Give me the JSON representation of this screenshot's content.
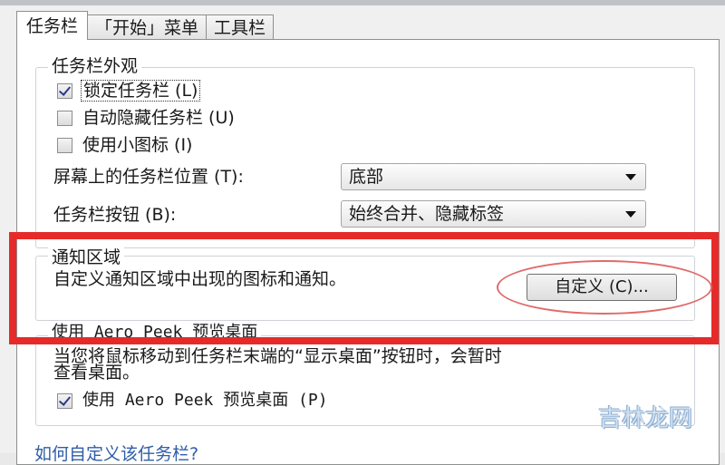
{
  "tabs": [
    {
      "label": "任务栏",
      "active": true
    },
    {
      "label": "「开始」菜单",
      "active": false
    },
    {
      "label": "工具栏",
      "active": false
    }
  ],
  "appearance": {
    "title": "任务栏外观",
    "lock_label": "锁定任务栏 (L)",
    "lock_checked": true,
    "autohide_label": "自动隐藏任务栏 (U)",
    "autohide_checked": false,
    "small_icons_label": "使用小图标 (I)",
    "small_icons_checked": false,
    "position_label": "屏幕上的任务栏位置 (T):",
    "position_value": "底部",
    "buttons_label": "任务栏按钮 (B):",
    "buttons_value": "始终合并、隐藏标签"
  },
  "notification": {
    "title": "通知区域",
    "description": "自定义通知区域中出现的图标和通知。",
    "customize_button": "自定义 (C)..."
  },
  "aero_peek": {
    "title": "使用 Aero Peek 预览桌面",
    "description_line1": "当您将鼠标移动到任务栏末端的“显示桌面”按钮时，会暂时",
    "description_line2": "查看桌面。",
    "checkbox_label": "使用 Aero Peek 预览桌面 (P)",
    "checked": true
  },
  "footer": {
    "link": "如何自定义该任务栏?"
  },
  "watermark": "吉林龙网",
  "colors": {
    "highlight": "#e62a2a",
    "link": "#2f5ea8"
  }
}
